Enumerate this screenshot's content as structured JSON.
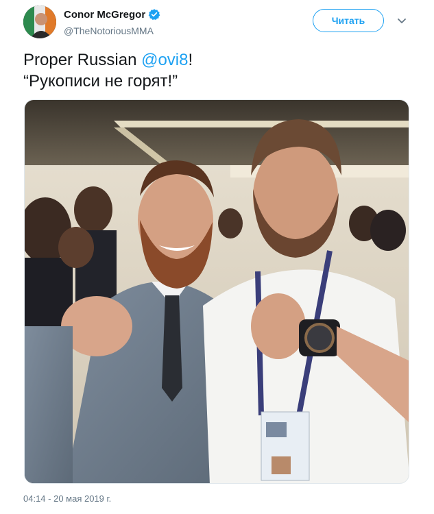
{
  "tweet": {
    "author": {
      "display_name": "Conor McGregor",
      "handle": "@TheNotoriousMMA",
      "verified": true,
      "verified_color": "#1da1f2"
    },
    "follow_label": "Читать",
    "menu_icon": "chevron-down-icon",
    "text": {
      "line1_prefix": "Proper Russian ",
      "line1_mention": "@ovi8",
      "line1_suffix": "!",
      "line2": "“Рукописи не горят!”"
    },
    "photo": {
      "description": "two-men-posing-with-fists-photo"
    },
    "timestamp": "04:14 - 20 мая 2019 г."
  },
  "colors": {
    "accent": "#1da1f2",
    "text_primary": "#14171a",
    "text_secondary": "#657786"
  }
}
